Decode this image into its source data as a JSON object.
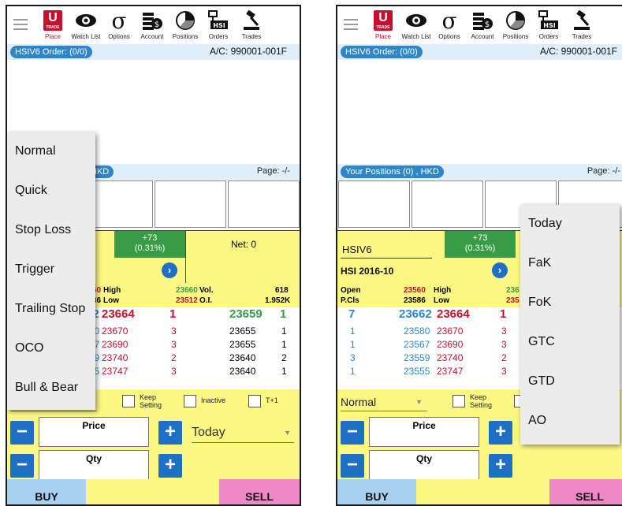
{
  "toolbar": {
    "items": [
      {
        "label": "Place",
        "icon": "place-order-icon"
      },
      {
        "label": "Watch List",
        "icon": "eye-icon"
      },
      {
        "label": "Options",
        "icon": "sigma-icon"
      },
      {
        "label": "Account",
        "icon": "coins-icon"
      },
      {
        "label": "Positions",
        "icon": "pie-chart-icon"
      },
      {
        "label": "Orders",
        "icon": "orders-icon"
      },
      {
        "label": "Trades",
        "icon": "gavel-icon"
      }
    ],
    "logo_text": "U",
    "logo_sub": "TRADE",
    "orders_icon_text": "HSI"
  },
  "order_header": {
    "badge": "HSIV6 Order: (0/0)",
    "account": "A/C: 990001-001F"
  },
  "positions": {
    "badge_full": "Your Positions (0) , HKD",
    "badge_partial": "HKD",
    "page": "Page: -/-"
  },
  "quote": {
    "symbol": "HSIV6",
    "contract": "HSI 2016-10",
    "change": "+73",
    "change_pct": "(0.31%)",
    "net": "Net: 0",
    "go": "›"
  },
  "ohlc": {
    "open_label": "Open",
    "open": "23560",
    "pcls_label": "P.Cls",
    "pcls": "23586",
    "high_label": "High",
    "high": "23660",
    "low_label": "Low",
    "low": "23512",
    "vol_label": "Vol.",
    "vol": "618",
    "oi_label": "O.I.",
    "oi": "1.952K",
    "open_frag": "60",
    "pcls_frag": "36",
    "high_frag_right": "236",
    "low_frag_right": "235",
    "vol_frag_right": "8",
    "oi_frag_right": "K"
  },
  "order_book": [
    {
      "bid_qty": "7",
      "bid": "23662",
      "ask": "23664",
      "ask_qty": "1",
      "last": "23659",
      "last_qty": "1",
      "bid_frag": "62"
    },
    {
      "bid_qty": "1",
      "bid": "23580",
      "ask": "23670",
      "ask_qty": "3",
      "last": "23655",
      "last_qty": "1",
      "bid_frag": "30"
    },
    {
      "bid_qty": "1",
      "bid": "23567",
      "ask": "23690",
      "ask_qty": "3",
      "last": "23655",
      "last_qty": "1",
      "bid_frag": "67"
    },
    {
      "bid_qty": "3",
      "bid": "23559",
      "ask": "23740",
      "ask_qty": "2",
      "last": "23640",
      "last_qty": "2",
      "bid_frag": "59"
    },
    {
      "bid_qty": "1",
      "bid": "23555",
      "ask": "23747",
      "ask_qty": "3",
      "last": "23640",
      "last_qty": "1",
      "bid_frag": "55"
    }
  ],
  "controls": {
    "order_type": "Normal",
    "keep_setting": "Keep Setting",
    "keep_line1": "Keep",
    "keep_line2": "Setting",
    "inactive": "Inactive",
    "t1": "T+1",
    "price_label": "Price",
    "qty_label": "Qty",
    "validity": "Today",
    "minus": "−",
    "plus": "+"
  },
  "actions": {
    "buy": "BUY",
    "sell": "SELL"
  },
  "order_type_menu": [
    "Normal",
    "Quick",
    "Stop Loss",
    "Trigger",
    "Trailing Stop",
    "OCO",
    "Bull & Bear"
  ],
  "validity_menu": [
    "Today",
    "FaK",
    "FoK",
    "GTC",
    "GTD",
    "AO"
  ],
  "colors": {
    "bid": "#2e86c8",
    "ask": "#c8102e",
    "up": "#3a9b46",
    "panel": "#fdf784",
    "buy": "#a8d0f0",
    "sell": "#f088c8"
  }
}
